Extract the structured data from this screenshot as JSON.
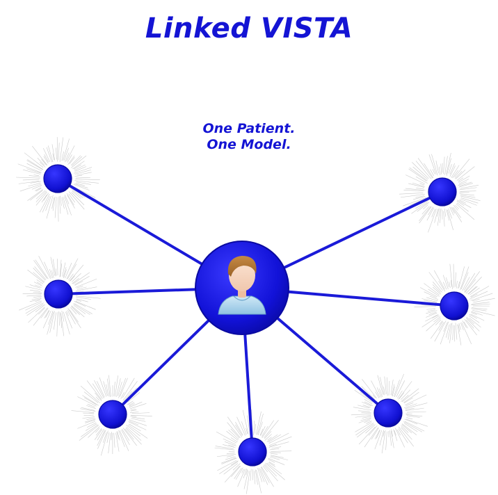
{
  "title": "Linked VISTA",
  "subtitle": {
    "line1": "One Patient.",
    "line2": "One Model."
  },
  "colors": {
    "text": "#1414d4",
    "node": "#1010d0",
    "edge": "#1a1ad8",
    "halo": "#c8c8c8"
  },
  "hub": {
    "icon": "patient-avatar-icon"
  },
  "satellites": [
    {
      "id": "node-1"
    },
    {
      "id": "node-2"
    },
    {
      "id": "node-3"
    },
    {
      "id": "node-4"
    },
    {
      "id": "node-5"
    },
    {
      "id": "node-6"
    },
    {
      "id": "node-7"
    },
    {
      "id": "node-8"
    }
  ]
}
